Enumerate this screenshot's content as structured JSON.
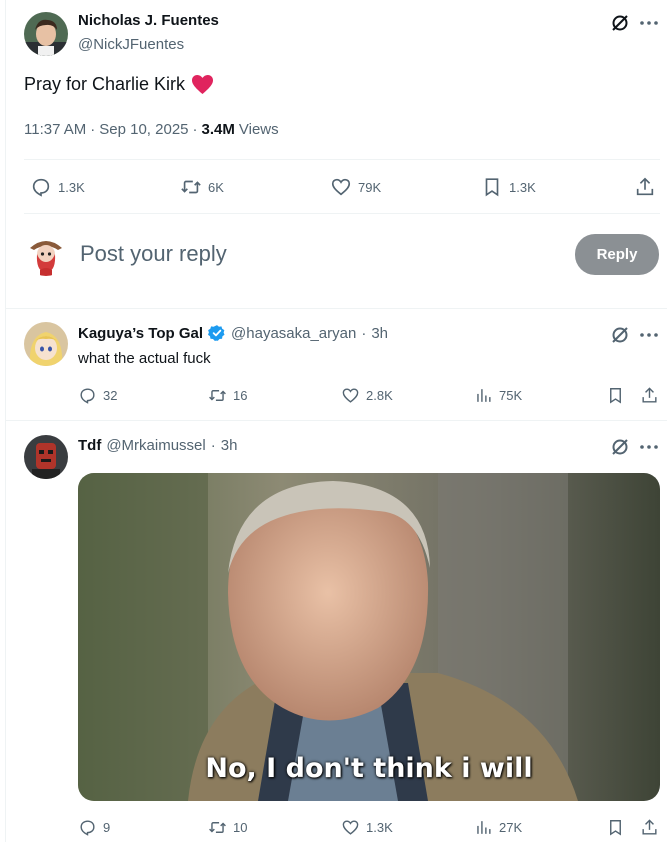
{
  "main_post": {
    "author_name": "Nicholas J. Fuentes",
    "author_handle": "@NickJFuentes",
    "text": "Pray for Charlie Kirk",
    "emoji": "❤️",
    "time": "11:37 AM",
    "date": "Sep 10, 2025",
    "views_count": "3.4M",
    "views_label": "Views",
    "stats": {
      "replies": "1.3K",
      "reposts": "6K",
      "likes": "79K",
      "bookmarks": "1.3K"
    }
  },
  "composer": {
    "placeholder": "Post your reply",
    "reply_button": "Reply"
  },
  "replies": [
    {
      "author_name": "Kaguya’s Top Gal",
      "verified": true,
      "author_handle": "@hayasaka_aryan",
      "time": "3h",
      "text": "what the actual fuck",
      "stats": {
        "replies": "32",
        "reposts": "16",
        "likes": "2.8K",
        "views": "75K"
      }
    },
    {
      "author_name": "Tdf",
      "author_handle": "@Mrkaimussel",
      "time": "3h",
      "image_caption": "No, I don't think i will",
      "stats": {
        "replies": "9",
        "reposts": "10",
        "likes": "1.3K",
        "views": "27K"
      }
    }
  ],
  "colors": {
    "heart": "#f91880",
    "verified": "#1d9bf0",
    "text_secondary": "#536471",
    "divider": "#eff3f4",
    "reply_button_disabled": "#8b9094"
  },
  "icons": [
    "grok-icon",
    "more-icon",
    "reply-icon",
    "repost-icon",
    "like-icon",
    "bookmark-icon",
    "share-icon",
    "views-icon",
    "verified-badge-icon"
  ]
}
